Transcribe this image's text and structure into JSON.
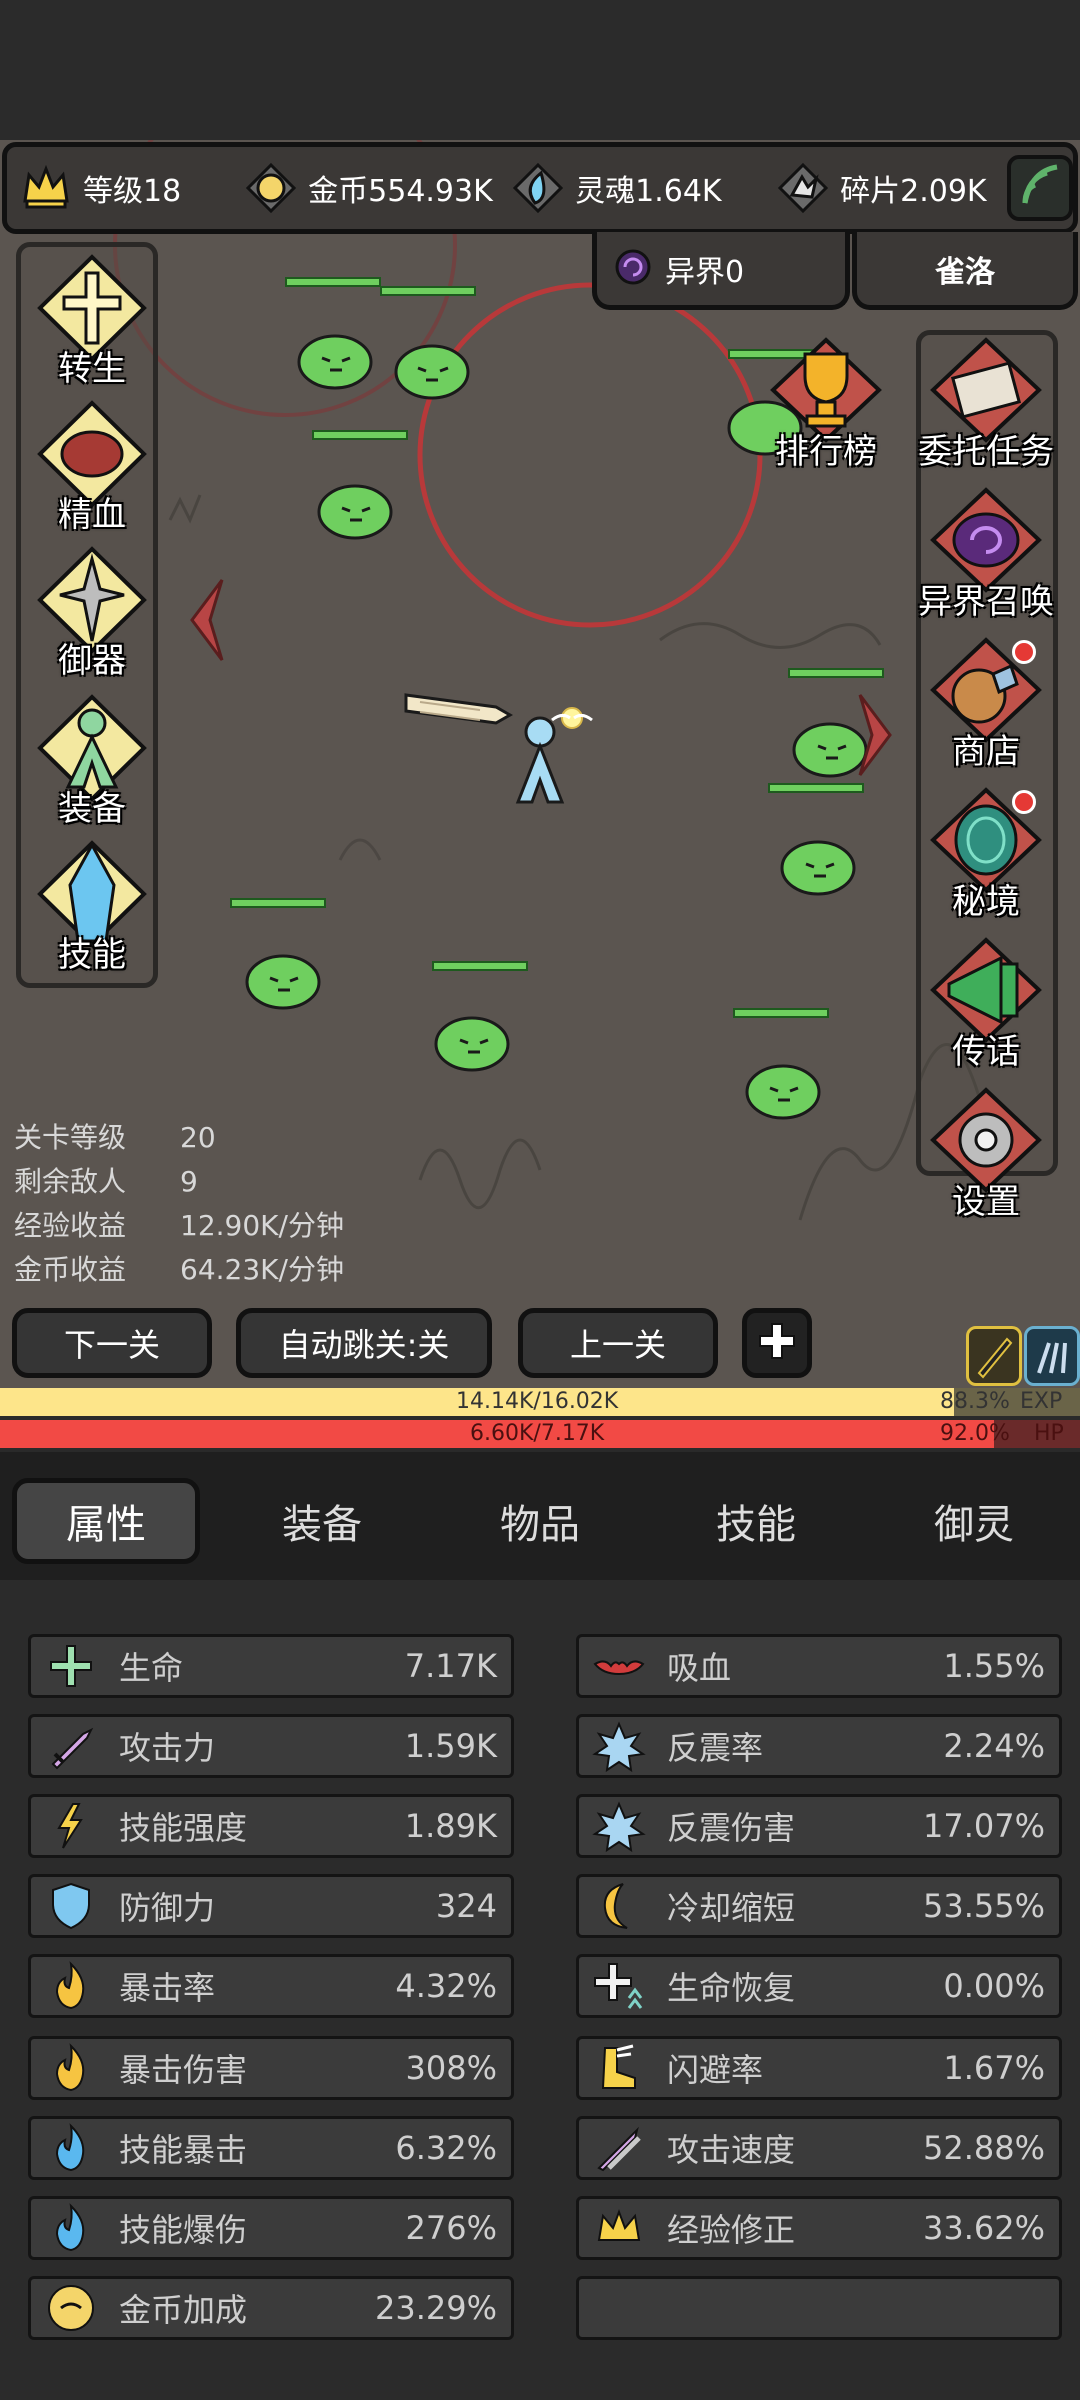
{
  "resources": {
    "level": "等级18",
    "gold": "金币554.93K",
    "soul": "灵魂1.64K",
    "shard": "碎片2.09K",
    "otherworld": "异界0",
    "player_name": "雀洛"
  },
  "left_menu": [
    "转生",
    "精血",
    "御器",
    "装备",
    "技能"
  ],
  "right_menu": [
    "排行榜",
    "委托任务",
    "异界召唤",
    "商店",
    "秘境",
    "传话",
    "设置"
  ],
  "stage_info": [
    {
      "label": "关卡等级",
      "value": "20"
    },
    {
      "label": "剩余敌人",
      "value": "9"
    },
    {
      "label": "经验收益",
      "value": "12.90K/分钟"
    },
    {
      "label": "金币收益",
      "value": "64.23K/分钟"
    }
  ],
  "actions": {
    "next": "下一关",
    "auto_skip": "自动跳关:关",
    "prev": "上一关"
  },
  "exp": {
    "text": "14.14K/16.02K",
    "percent": "88.3%",
    "label": "EXP",
    "fraction": 0.883
  },
  "hp": {
    "text": "6.60K/7.17K",
    "percent": "92.0%",
    "label": "HP",
    "fraction": 0.92
  },
  "tabs": [
    "属性",
    "装备",
    "物品",
    "技能",
    "御灵"
  ],
  "active_tab": "属性",
  "stats_left": [
    {
      "name": "生命",
      "value": "7.17K",
      "icon": "heal-cross-icon"
    },
    {
      "name": "攻击力",
      "value": "1.59K",
      "icon": "sword-icon"
    },
    {
      "name": "技能强度",
      "value": "1.89K",
      "icon": "lightning-icon"
    },
    {
      "name": "防御力",
      "value": "324",
      "icon": "shield-icon"
    },
    {
      "name": "暴击率",
      "value": "4.32%",
      "icon": "fire-icon"
    },
    {
      "name": "暴击伤害",
      "value": "308%",
      "icon": "fire-icon"
    },
    {
      "name": "技能暴击",
      "value": "6.32%",
      "icon": "blue-fire-icon"
    },
    {
      "name": "技能爆伤",
      "value": "276%",
      "icon": "blue-fire-icon"
    },
    {
      "name": "金币加成",
      "value": "23.29%",
      "icon": "coin-icon"
    }
  ],
  "stats_right": [
    {
      "name": "吸血",
      "value": "1.55%",
      "icon": "bat-icon"
    },
    {
      "name": "反震率",
      "value": "2.24%",
      "icon": "thorn-icon"
    },
    {
      "name": "反震伤害",
      "value": "17.07%",
      "icon": "thorn-icon"
    },
    {
      "name": "冷却缩短",
      "value": "53.55%",
      "icon": "moon-icon"
    },
    {
      "name": "生命恢复",
      "value": "0.00%",
      "icon": "regen-icon"
    },
    {
      "name": "闪避率",
      "value": "1.67%",
      "icon": "boot-icon"
    },
    {
      "name": "攻击速度",
      "value": "52.88%",
      "icon": "swords-icon"
    },
    {
      "name": "经验修正",
      "value": "33.62%",
      "icon": "crown-icon"
    },
    {
      "name": "",
      "value": "",
      "icon": ""
    }
  ],
  "colors": {
    "exp_fill": "#fde58a",
    "hp_fill": "#f24a45",
    "field_bg": "#5b5550",
    "slime": "#6fcf5f"
  }
}
